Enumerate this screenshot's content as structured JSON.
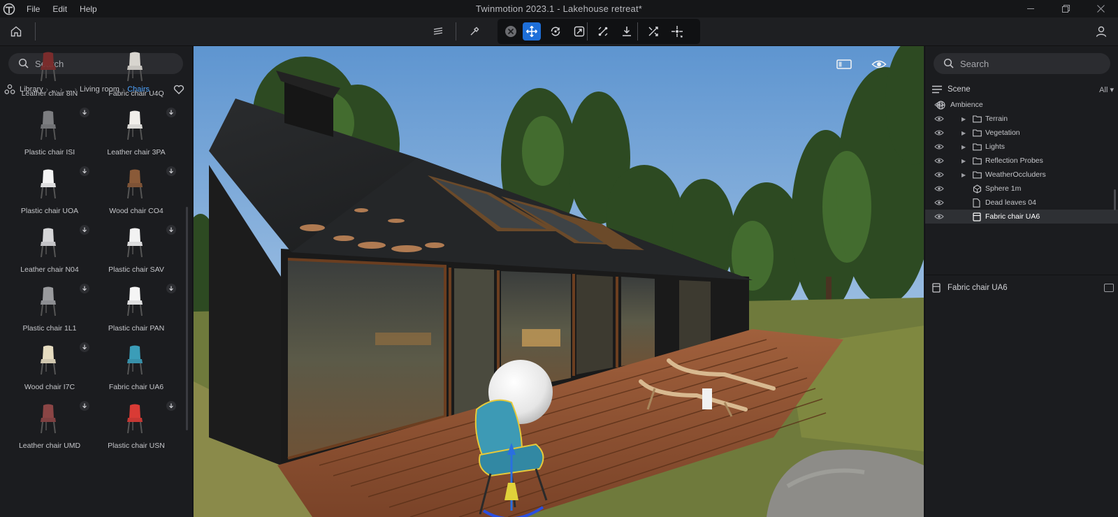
{
  "app": {
    "menu": [
      "File",
      "Edit",
      "Help"
    ],
    "title": "Twinmotion 2023.1 - Lakehouse retreat*",
    "logo_icon": "twinmotion-logo",
    "window_controls": [
      "minimize-icon",
      "restore-icon",
      "close-icon"
    ]
  },
  "toolbar": {
    "left_icon": "home-icon",
    "right_icon": "user-icon",
    "tools": [
      {
        "icon": "layers-icon",
        "active": false
      },
      {
        "icon": "eyedropper-icon",
        "active": false
      },
      {
        "icon": "deselect-icon",
        "active": false
      },
      {
        "icon": "move-icon",
        "active": true
      },
      {
        "icon": "rotate-icon",
        "active": false
      },
      {
        "icon": "scale-icon",
        "active": false
      },
      {
        "icon": "snap-icon",
        "active": false
      },
      {
        "icon": "drop-to-floor-icon",
        "active": false
      },
      {
        "icon": "random-transform-icon",
        "active": false
      },
      {
        "icon": "pivot-icon",
        "active": false
      }
    ]
  },
  "library": {
    "search_placeholder": "Search",
    "breadcrumb": [
      "Library",
      "...",
      "...",
      "Living room",
      "Chairs"
    ],
    "items": [
      {
        "label": "Leather chair 8IN",
        "seat": "#7a2c2c",
        "download": false
      },
      {
        "label": "Fabric chair U4Q",
        "seat": "#d8d5cf",
        "download": false
      },
      {
        "label": "Plastic chair ISI",
        "seat": "#7c7d80",
        "download": true
      },
      {
        "label": "Leather chair 3PA",
        "seat": "#f0eeea",
        "download": true
      },
      {
        "label": "Plastic chair UOA",
        "seat": "#f4f4f4",
        "download": true
      },
      {
        "label": "Wood chair CO4",
        "seat": "#8a5a38",
        "download": true
      },
      {
        "label": "Leather chair N04",
        "seat": "#d6d6d8",
        "download": true
      },
      {
        "label": "Plastic chair SAV",
        "seat": "#f2f2f2",
        "download": true
      },
      {
        "label": "Plastic chair 1L1",
        "seat": "#9a9b9e",
        "download": true
      },
      {
        "label": "Plastic chair PAN",
        "seat": "#f5f5f5",
        "download": true
      },
      {
        "label": "Wood chair I7C",
        "seat": "#e6dcc0",
        "download": true
      },
      {
        "label": "Fabric chair UA6",
        "seat": "#3b9db8",
        "download": false
      },
      {
        "label": "Leather chair UMD",
        "seat": "#8b4545",
        "download": true
      },
      {
        "label": "Plastic chair USN",
        "seat": "#d93b35",
        "download": true
      }
    ]
  },
  "viewport": {
    "icons": [
      "screen-icon",
      "eye-icon"
    ]
  },
  "scene": {
    "search_placeholder": "Search",
    "title": "Scene",
    "filter": "All",
    "tree": [
      {
        "label": "Ambience",
        "icon": "globe-icon",
        "level": 0,
        "arrow": false,
        "selected": false
      },
      {
        "label": "Terrain",
        "icon": "folder-icon",
        "level": 1,
        "arrow": true,
        "selected": false
      },
      {
        "label": "Vegetation",
        "icon": "folder-icon",
        "level": 1,
        "arrow": true,
        "selected": false
      },
      {
        "label": "Lights",
        "icon": "folder-icon",
        "level": 1,
        "arrow": true,
        "selected": false
      },
      {
        "label": "Reflection Probes",
        "icon": "folder-icon",
        "level": 1,
        "arrow": true,
        "selected": false
      },
      {
        "label": "WeatherOccluders",
        "icon": "folder-icon",
        "level": 1,
        "arrow": true,
        "selected": false
      },
      {
        "label": "Sphere 1m",
        "icon": "sphere-icon",
        "level": 1,
        "arrow": false,
        "selected": false
      },
      {
        "label": "Dead leaves 04",
        "icon": "file-icon",
        "level": 1,
        "arrow": false,
        "selected": false
      },
      {
        "label": "Fabric chair UA6",
        "icon": "object-icon",
        "level": 1,
        "arrow": false,
        "selected": true
      }
    ],
    "properties_title": "Fabric chair UA6"
  }
}
